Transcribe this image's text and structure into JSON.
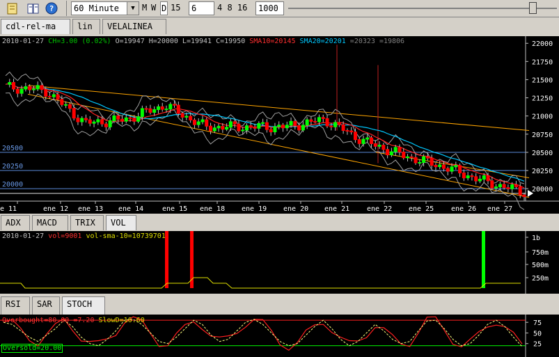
{
  "toolbar": {
    "interval": "60 Minute",
    "periods": [
      "M",
      "W",
      "D"
    ],
    "days": "15",
    "ma_period": "6",
    "ma_list": "4 8 16",
    "bars": "1000"
  },
  "chart_tabs": [
    "cdl-rel-ma",
    "lin",
    "VELALINEA"
  ],
  "main_header": {
    "date": "2010-01-27",
    "ch": "CH=3.00 (0.02%)",
    "ohlc": "O=19947 H=20000 L=19941 C=19950",
    "sma10": "SMA10=20145",
    "sma20": "SMA20=20201",
    "bands": "=20323 =19806"
  },
  "price_axis": [
    "22000",
    "21750",
    "21500",
    "21250",
    "21000",
    "20750",
    "20500",
    "20250",
    "20000"
  ],
  "level_labels": [
    "20500",
    "20250",
    "20000"
  ],
  "date_axis": [
    "e 11",
    "ene 12",
    "ene 13",
    "ene 14",
    "ene 15",
    "ene 18",
    "ene 19",
    "ene 20",
    "ene 21",
    "ene 22",
    "ene 25",
    "ene 26",
    "ene 27"
  ],
  "indicator_tabs": [
    "ADX",
    "MACD",
    "TRIX",
    "VOL"
  ],
  "vol_header": {
    "date": "2010-01-27",
    "vol": "vol=9001",
    "vol_sma": "vol-sma-10=10739701"
  },
  "vol_axis": [
    "1b",
    "750m",
    "500m",
    "250m"
  ],
  "osc_tabs": [
    "RSI",
    "SAR",
    "STOCH"
  ],
  "stoch_header": {
    "overbought": "Overbought=80.00",
    "slowk": "=7.20",
    "slowd": "SlowD=16.60",
    "oversold": "Oversold=20.00"
  },
  "stoch_axis": [
    "75",
    "50",
    "25"
  ],
  "chart_data": [
    {
      "type": "candlestick",
      "title": "",
      "ylim": [
        19800,
        22050
      ],
      "x": [
        "e 11",
        "ene 12",
        "ene 13",
        "ene 14",
        "ene 15",
        "ene 18",
        "ene 19",
        "ene 20",
        "ene 21",
        "ene 22",
        "ene 25",
        "ene 26",
        "ene 27"
      ],
      "close": [
        21400,
        21350,
        20900,
        20950,
        21150,
        20850,
        20850,
        20850,
        20950,
        20650,
        20450,
        20300,
        20100,
        19950
      ],
      "reference_levels": [
        20500,
        20250,
        20000
      ],
      "colors": {
        "up": "#00ff00",
        "down": "#ff0000",
        "sma10": "#ff0000",
        "sma20": "#00c8ff",
        "channel": "#ffa500",
        "bands": "#b0b0b0"
      }
    },
    {
      "type": "bar",
      "title": "VOL",
      "ylim": [
        0,
        1000
      ],
      "spikes_m": [
        1000,
        1000,
        1000
      ],
      "spike_colors": [
        "#ff0000",
        "#ff0000",
        "#00ff00"
      ]
    },
    {
      "type": "line",
      "title": "STOCH",
      "ylim": [
        0,
        90
      ],
      "levels": [
        80,
        20
      ],
      "series": [
        {
          "name": "SlowD",
          "values": [
            75,
            70,
            55,
            40,
            30,
            45,
            60,
            80,
            65,
            40,
            25,
            20,
            35,
            55,
            80,
            82,
            70,
            50,
            30,
            25,
            40,
            60,
            80,
            70,
            45,
            30,
            35,
            55,
            75,
            82,
            70,
            50,
            30,
            20,
            25,
            45,
            65,
            80,
            60,
            35,
            20,
            30,
            50,
            70,
            55,
            35,
            25,
            30,
            55,
            78,
            80,
            60,
            35,
            20,
            25,
            45,
            70,
            80,
            65,
            40,
            18
          ]
        }
      ]
    }
  ]
}
